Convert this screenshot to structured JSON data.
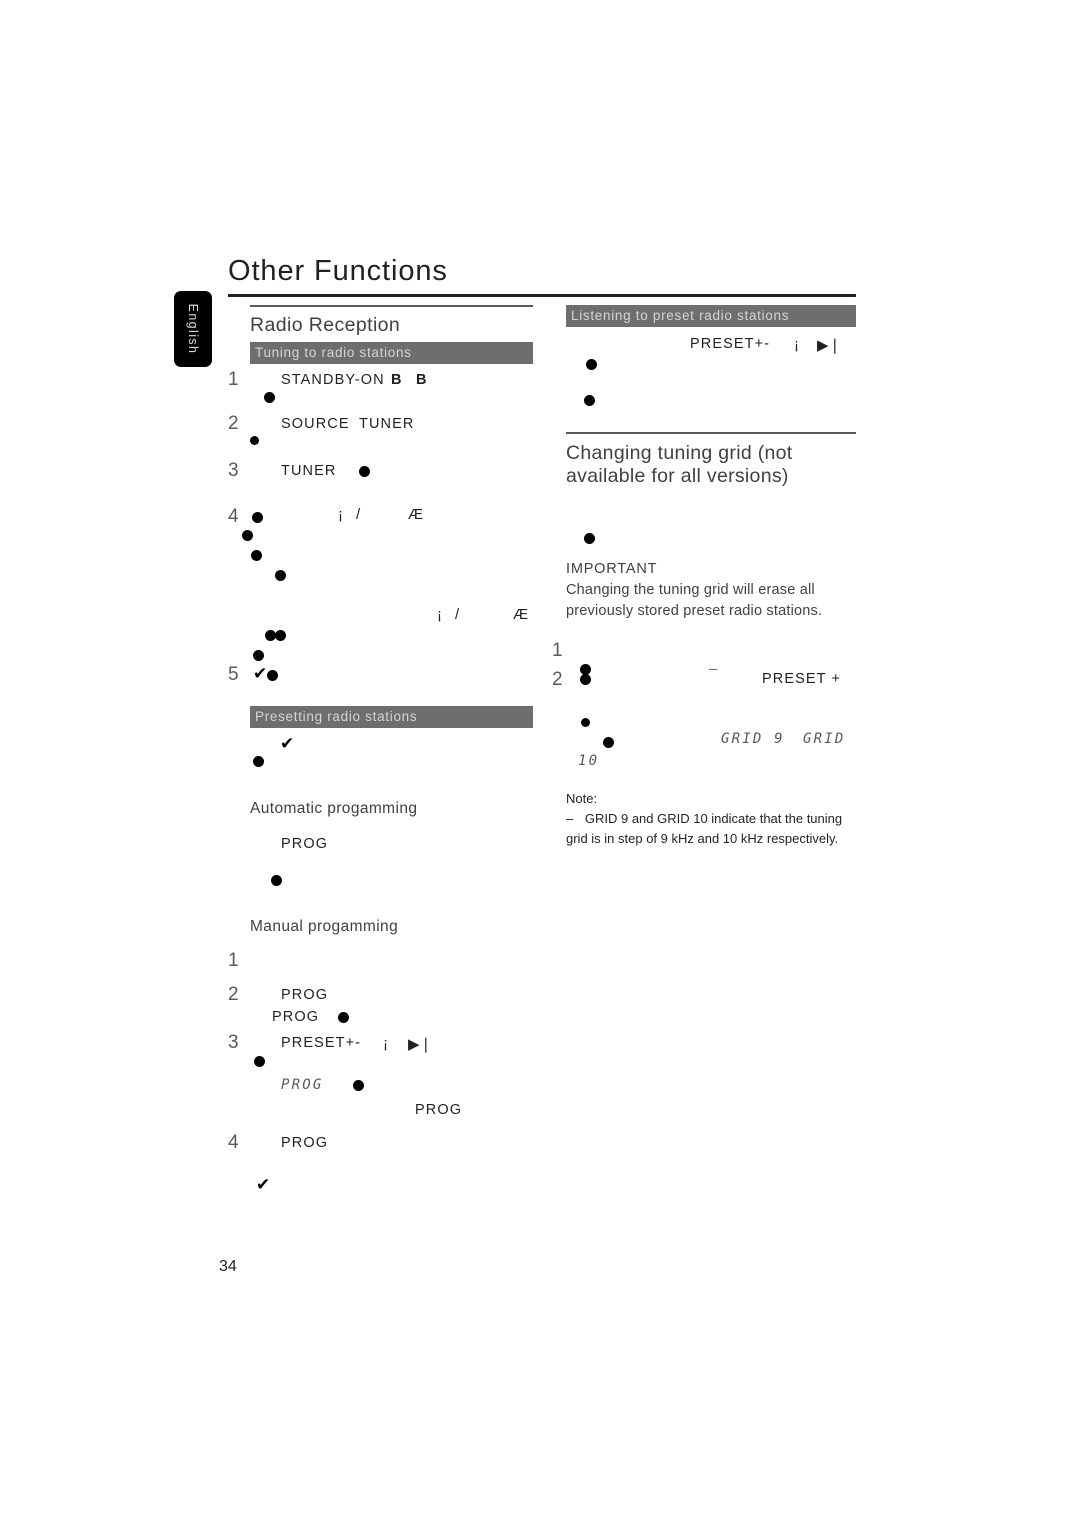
{
  "page": {
    "title": "Other Functions",
    "number": "34",
    "language_tab": "English"
  },
  "left_column": {
    "section_heading": "Radio Reception",
    "bars": {
      "tuning": "Tuning to radio stations",
      "presetting": "Presetting radio stations"
    },
    "tuning_steps": [
      {
        "num": "1",
        "keyword": "STANDBY-ON",
        "bold_marks": [
          "B",
          "B"
        ],
        "bullet": "●"
      },
      {
        "num": "2",
        "keyword_a": "SOURCE",
        "keyword_b": "TUNER",
        "bullet": "●"
      },
      {
        "num": "3",
        "keyword": "TUNER",
        "bullet": "●"
      },
      {
        "num": "4",
        "sym_a": "¡",
        "sym_slash": "/",
        "sym_b": "Æ"
      },
      {
        "num": "5",
        "check": "✔",
        "bullet": "●"
      }
    ],
    "tuning_repeat_symbols": {
      "sym_a": "¡",
      "sym_slash": "/",
      "sym_b": "Æ"
    },
    "subheads": {
      "automatic": "Automatic progamming",
      "manual": "Manual progamming"
    },
    "prog_label": "PROG",
    "manual_steps": [
      {
        "num": "1"
      },
      {
        "num": "2",
        "kw_a": "PROG",
        "kw_b": "PROG",
        "bullet": "●"
      },
      {
        "num": "3",
        "kw": "PRESET+-",
        "sym_a": "¡",
        "sym_b": "▶❘",
        "lcd": "PROG",
        "kw_tail": "PROG",
        "bullet": "●"
      },
      {
        "num": "4",
        "kw": "PROG",
        "check": "✔"
      }
    ]
  },
  "right_column": {
    "bars": {
      "listening": "Listening to preset radio stations"
    },
    "preset_line": {
      "kw": "PRESET+-",
      "sym_a": "¡",
      "sym_b": "▶❘"
    },
    "grid_heading_main": "Changing tuning grid",
    "grid_heading_italic": "(not available for all versions)",
    "important": {
      "label": "IMPORTANT",
      "text": "Changing the tuning grid will erase all previously stored preset radio stations."
    },
    "grid_steps": [
      {
        "num": "1",
        "bullet": "●"
      },
      {
        "num": "2",
        "bullet": "●",
        "dash": "¯",
        "kw": "PRESET +"
      }
    ],
    "lcd_values": {
      "grid9": "GRID 9",
      "grid10a": "GRID",
      "grid10b": "10"
    },
    "note": {
      "label": "Note:",
      "dash": "–",
      "line1": "GRID 9 and GRID 10 indicate that the tuning",
      "line2": "grid is in step of 9 kHz and 10 kHz respectively."
    }
  },
  "colors": {
    "bar_bg": "#6e6e6e",
    "bar_text": "#d5d5d5",
    "heading": "#414042",
    "rule": "#231f20",
    "lcd": "#58595b"
  }
}
